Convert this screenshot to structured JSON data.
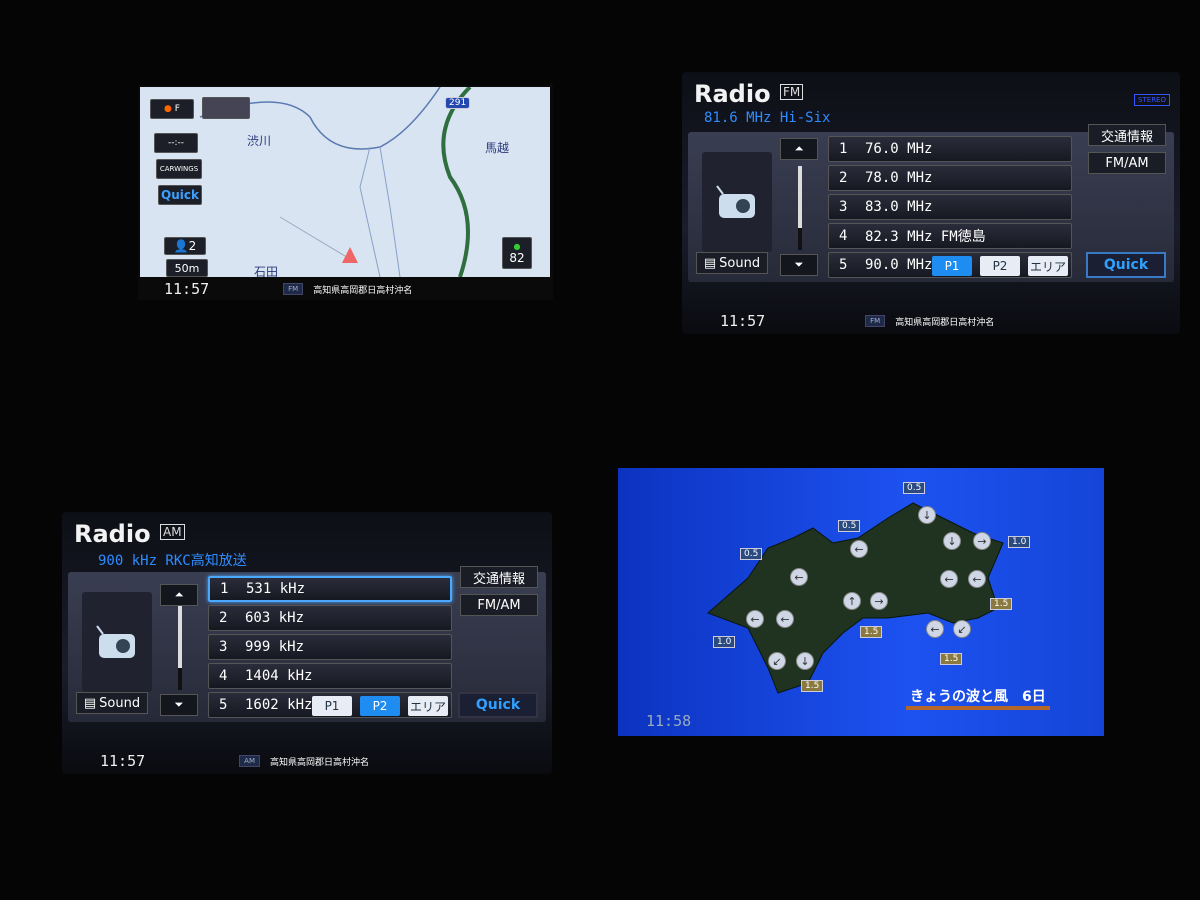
{
  "navigation": {
    "compass_label": "F",
    "eta_label": "--:--",
    "carwings_label": "CARWINGS",
    "quick_label": "Quick",
    "places": [
      "渋川",
      "馬越",
      "石田"
    ],
    "route_number": "291",
    "people_count": "2",
    "scale": "50m",
    "eco_score": "82",
    "clock": "11:57",
    "source": "FM",
    "address": "高知県高岡郡日高村沖名"
  },
  "radio_fm": {
    "title": "Radio",
    "band": "FM",
    "stereo": "STEREO",
    "station": "81.6 MHz Hi-Six",
    "presets": [
      {
        "num": "1",
        "freq": "76.0 MHz"
      },
      {
        "num": "2",
        "freq": "78.0 MHz"
      },
      {
        "num": "3",
        "freq": "83.0 MHz"
      },
      {
        "num": "4",
        "freq": "82.3 MHz FM徳島"
      },
      {
        "num": "5",
        "freq": "90.0 MHz"
      }
    ],
    "traffic_label": "交通情報",
    "fmam_label": "FM/AM",
    "sound_label": "Sound",
    "page_buttons": [
      "P1",
      "P2",
      "エリア"
    ],
    "active_page": "P1",
    "quick_label": "Quick",
    "clock": "11:57",
    "source": "FM",
    "address": "高知県高岡郡日高村沖名"
  },
  "radio_am": {
    "title": "Radio",
    "band": "AM",
    "station": "900 kHz RKC高知放送",
    "presets": [
      {
        "num": "1",
        "freq": "531 kHz"
      },
      {
        "num": "2",
        "freq": "603 kHz"
      },
      {
        "num": "3",
        "freq": "999 kHz"
      },
      {
        "num": "4",
        "freq": "1404 kHz"
      },
      {
        "num": "5",
        "freq": "1602 kHz"
      }
    ],
    "selected_preset": "1",
    "traffic_label": "交通情報",
    "fmam_label": "FM/AM",
    "sound_label": "Sound",
    "page_buttons": [
      "P1",
      "P2",
      "エリア"
    ],
    "active_page": "P2",
    "quick_label": "Quick",
    "clock": "11:57",
    "source": "AM",
    "address": "高知県高岡郡日高村沖名"
  },
  "weather": {
    "title": "きょうの波と風　6日",
    "clock": "11:58",
    "waves": [
      "0.5",
      "0.5",
      "0.5",
      "1.0",
      "1.5",
      "1.5",
      "1.5",
      "1.0",
      "1.5"
    ]
  },
  "colors": {
    "accent": "#2f8cff",
    "weather_bg": "#1d52f0",
    "land": "#1f3320"
  }
}
